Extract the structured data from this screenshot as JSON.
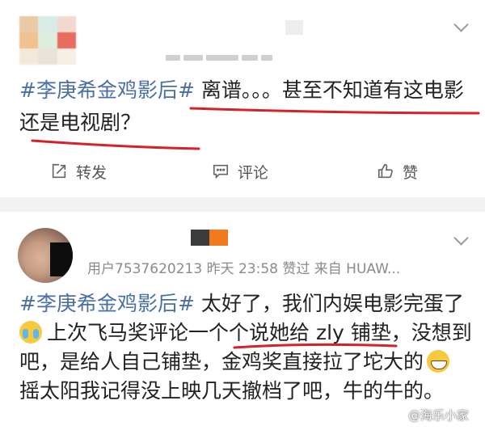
{
  "post1": {
    "hashtag": "#李庚希金鸡影后#",
    "line1_text": " 离谱。。。甚至不知道有这电影",
    "line2_text": "还是电视剧？",
    "actions": {
      "repost_label": "转发",
      "comment_label": "评论",
      "like_label": "赞"
    },
    "icons": [
      "repost-icon",
      "comment-icon",
      "like-icon",
      "chevron-down-icon"
    ]
  },
  "post2": {
    "meta": "用户7537620213 昨天 23:58 赞过  来自 HUAW...",
    "hashtag": "#李庚希金鸡影后#",
    "line1_text": " 太好了，我们内娱电影完蛋了",
    "line2_text": "上次飞马奖评论一个个说她给 zly 铺垫，没想到",
    "line3_text": "吧，是给人自己铺垫，金鸡奖直接拉了坨大的",
    "line4_text": "摇太阳我记得没上映几天撤档了吧，牛的牛的。",
    "emojis": [
      "crying-emoji",
      "grinning-emoji"
    ]
  },
  "watermark": "@海乐小家",
  "colors": {
    "hashtag": "#4a6fa5",
    "underline": "#d6202a",
    "separator": "#f2f2f2",
    "meta_text": "#8a8a8a"
  }
}
